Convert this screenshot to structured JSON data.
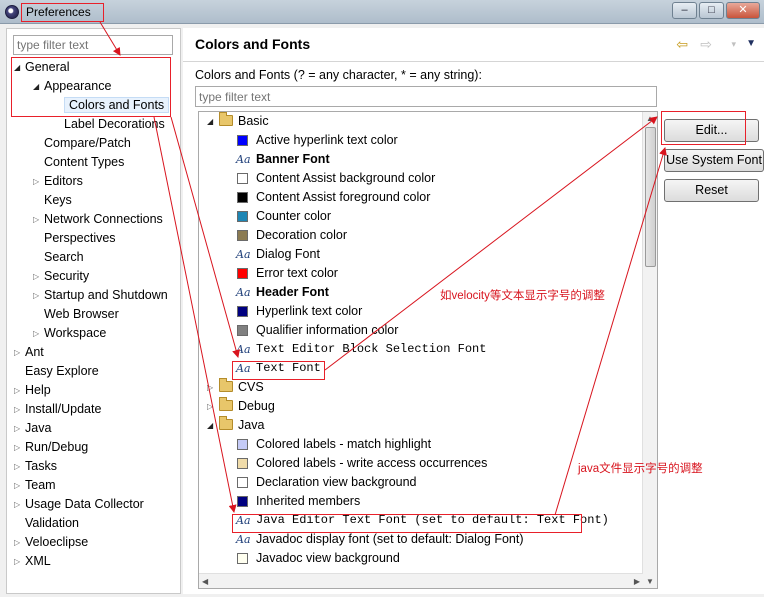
{
  "window": {
    "title": "Preferences",
    "controls": [
      "–",
      "□",
      "✕"
    ]
  },
  "sidebar": {
    "filter_placeholder": "type filter text",
    "tree": [
      {
        "label": "General",
        "level": 0,
        "toggle": "open"
      },
      {
        "label": "Appearance",
        "level": 1,
        "toggle": "open"
      },
      {
        "label": "Colors and Fonts",
        "level": 2,
        "toggle": "none",
        "selected": true
      },
      {
        "label": "Label Decorations",
        "level": 2,
        "toggle": "none"
      },
      {
        "label": "Compare/Patch",
        "level": 1,
        "toggle": "none"
      },
      {
        "label": "Content Types",
        "level": 1,
        "toggle": "none"
      },
      {
        "label": "Editors",
        "level": 1,
        "toggle": "closed"
      },
      {
        "label": "Keys",
        "level": 1,
        "toggle": "none"
      },
      {
        "label": "Network Connections",
        "level": 1,
        "toggle": "closed"
      },
      {
        "label": "Perspectives",
        "level": 1,
        "toggle": "none"
      },
      {
        "label": "Search",
        "level": 1,
        "toggle": "none"
      },
      {
        "label": "Security",
        "level": 1,
        "toggle": "closed"
      },
      {
        "label": "Startup and Shutdown",
        "level": 1,
        "toggle": "closed"
      },
      {
        "label": "Web Browser",
        "level": 1,
        "toggle": "none"
      },
      {
        "label": "Workspace",
        "level": 1,
        "toggle": "closed"
      },
      {
        "label": "Ant",
        "level": 0,
        "toggle": "closed"
      },
      {
        "label": "Easy Explore",
        "level": 0,
        "toggle": "none"
      },
      {
        "label": "Help",
        "level": 0,
        "toggle": "closed"
      },
      {
        "label": "Install/Update",
        "level": 0,
        "toggle": "closed"
      },
      {
        "label": "Java",
        "level": 0,
        "toggle": "closed"
      },
      {
        "label": "Run/Debug",
        "level": 0,
        "toggle": "closed"
      },
      {
        "label": "Tasks",
        "level": 0,
        "toggle": "closed"
      },
      {
        "label": "Team",
        "level": 0,
        "toggle": "closed"
      },
      {
        "label": "Usage Data Collector",
        "level": 0,
        "toggle": "closed"
      },
      {
        "label": "Validation",
        "level": 0,
        "toggle": "none"
      },
      {
        "label": "Veloeclipse",
        "level": 0,
        "toggle": "closed"
      },
      {
        "label": "XML",
        "level": 0,
        "toggle": "closed"
      }
    ]
  },
  "main": {
    "title": "Colors and Fonts",
    "description": "Colors and Fonts (? = any character, * = any string):",
    "filter_placeholder": "type filter text",
    "nav_icons": [
      "back-arrow-icon",
      "forward-arrow-icon",
      "view-menu-icon"
    ],
    "items": [
      {
        "label": "Basic",
        "kind": "category",
        "toggle": "open"
      },
      {
        "label": "Active hyperlink text color",
        "kind": "color",
        "color": "#0000ff"
      },
      {
        "label": "Banner Font",
        "kind": "font",
        "style": "bold"
      },
      {
        "label": "Content Assist background color",
        "kind": "color",
        "color": "#ffffff"
      },
      {
        "label": "Content Assist foreground color",
        "kind": "color",
        "color": "#000000"
      },
      {
        "label": "Counter color",
        "kind": "color",
        "color": "#1e86b4"
      },
      {
        "label": "Decoration color",
        "kind": "color",
        "color": "#8b7b52"
      },
      {
        "label": "Dialog Font",
        "kind": "font",
        "style": "normal"
      },
      {
        "label": "Error text color",
        "kind": "color",
        "color": "#ff0000"
      },
      {
        "label": "Header Font",
        "kind": "font",
        "style": "bold"
      },
      {
        "label": "Hyperlink text color",
        "kind": "color",
        "color": "#000080"
      },
      {
        "label": "Qualifier information color",
        "kind": "color",
        "color": "#808080"
      },
      {
        "label": "Text Editor Block Selection Font",
        "kind": "font",
        "style": "mono"
      },
      {
        "label": "Text Font",
        "kind": "font",
        "style": "mono"
      },
      {
        "label": "CVS",
        "kind": "category",
        "toggle": "closed"
      },
      {
        "label": "Debug",
        "kind": "category",
        "toggle": "closed"
      },
      {
        "label": "Java",
        "kind": "category",
        "toggle": "open"
      },
      {
        "label": "Colored labels - match highlight",
        "kind": "color",
        "color": "#c5cbf7"
      },
      {
        "label": "Colored labels - write access occurrences",
        "kind": "color",
        "color": "#f0dcaa"
      },
      {
        "label": "Declaration view background",
        "kind": "color",
        "color": "#ffffff"
      },
      {
        "label": "Inherited members",
        "kind": "color",
        "color": "#000080"
      },
      {
        "label": "Java Editor Text Font (set to default: Text Font)",
        "kind": "font",
        "style": "mono"
      },
      {
        "label": "Javadoc display font (set to default: Dialog Font)",
        "kind": "font",
        "style": "normal"
      },
      {
        "label": "Javadoc view background",
        "kind": "color",
        "color": "#fffff0"
      }
    ]
  },
  "buttons": {
    "edit": "Edit...",
    "use_system_font": "Use System Font",
    "reset": "Reset"
  },
  "annotations": {
    "velocity_note": "如velocity等文本显示字号的调整",
    "java_note": "java文件显示字号的调整",
    "color": "#e8202a"
  }
}
